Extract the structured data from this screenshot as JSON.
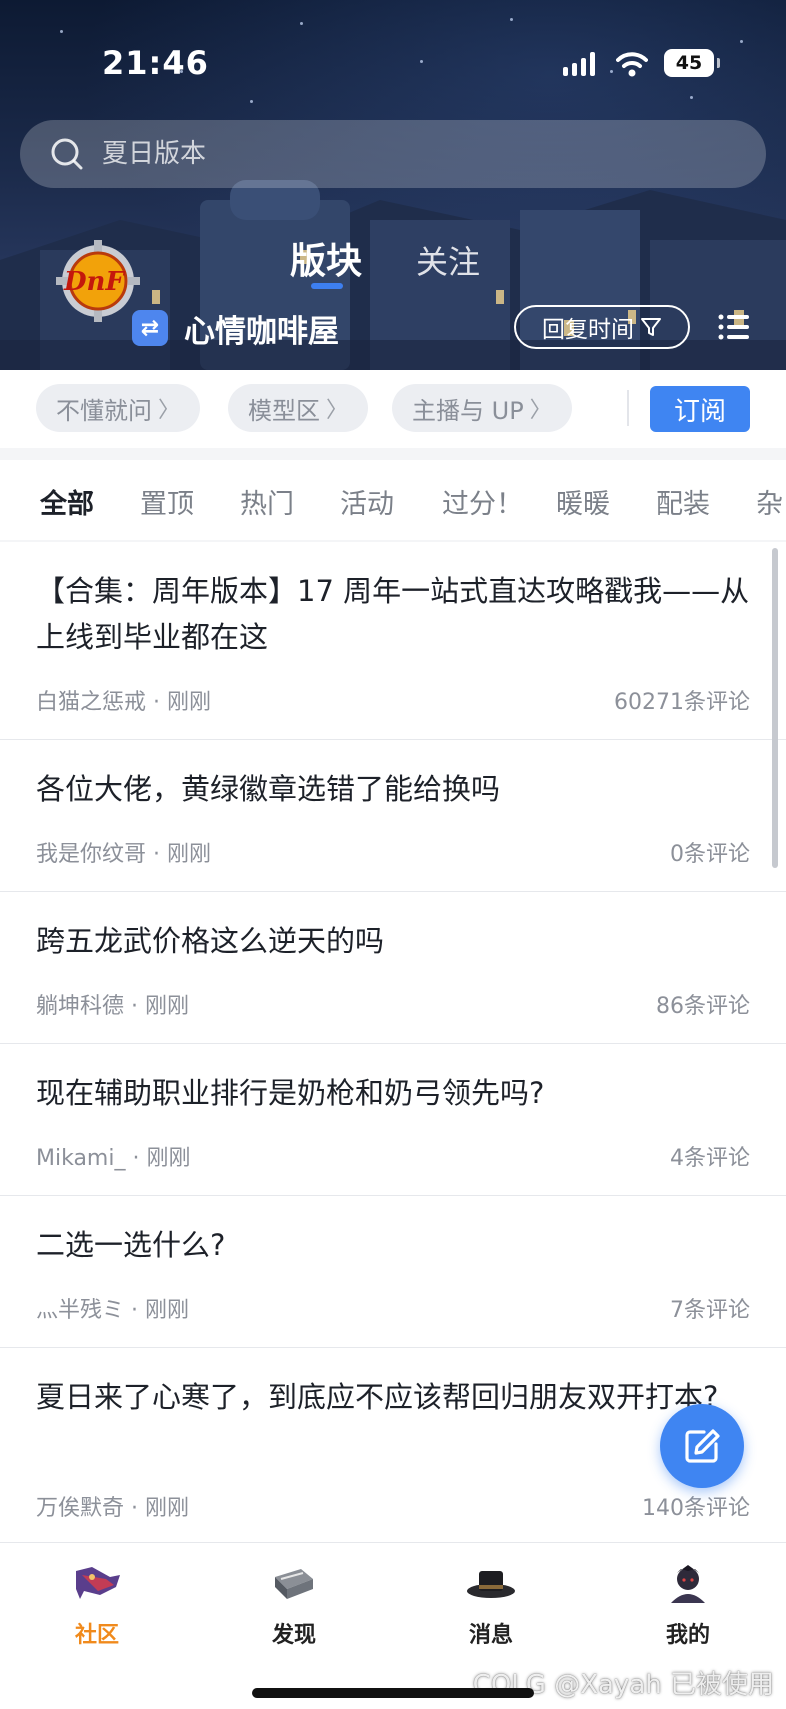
{
  "status_bar": {
    "time": "21:46",
    "battery": "45"
  },
  "search": {
    "placeholder": "夏日版本"
  },
  "header": {
    "logo_text": "DnF",
    "tabs": [
      {
        "label": "版块"
      },
      {
        "label": "关注"
      }
    ],
    "forum_name": "心情咖啡屋",
    "sort_label": "回复时间"
  },
  "sub_sections": [
    {
      "label": "不懂就问"
    },
    {
      "label": "模型区"
    },
    {
      "label": "主播与 UP"
    }
  ],
  "subscribe_label": "订阅",
  "categories": [
    {
      "label": "全部"
    },
    {
      "label": "置顶"
    },
    {
      "label": "热门"
    },
    {
      "label": "活动"
    },
    {
      "label": "过分！"
    },
    {
      "label": "暖暖"
    },
    {
      "label": "配装"
    },
    {
      "label": "杂"
    }
  ],
  "posts": [
    {
      "title": "【合集：周年版本】17 周年一站式直达攻略戳我——从上线到毕业都在这",
      "author": "白猫之惩戒",
      "time": "刚刚",
      "comments": "60271条评论"
    },
    {
      "title": "各位大佬，黄绿徽章选错了能给换吗",
      "author": "我是你纹哥",
      "time": "刚刚",
      "comments": "0条评论"
    },
    {
      "title": "跨五龙武价格这么逆天的吗",
      "author": "躺坤科德",
      "time": "刚刚",
      "comments": "86条评论"
    },
    {
      "title": "现在辅助职业排行是奶枪和奶弓领先吗?",
      "author": "Mikami_",
      "time": "刚刚",
      "comments": "4条评论"
    },
    {
      "title": "二选一选什么?",
      "author": "灬半残ミ",
      "time": "刚刚",
      "comments": "7条评论"
    },
    {
      "title": "夏日来了心寒了，到底应不应该帮回归朋友双开打本?",
      "author": "万俟默奇",
      "time": "刚刚",
      "comments": "140条评论"
    }
  ],
  "meta_separator": "·",
  "bottom_nav": [
    {
      "label": "社区"
    },
    {
      "label": "发现"
    },
    {
      "label": "消息"
    },
    {
      "label": "我的"
    }
  ],
  "watermark": "COLG @Xayah 已被使用",
  "colors": {
    "accent": "#3f85f2",
    "active_nav": "#f08a1c"
  }
}
